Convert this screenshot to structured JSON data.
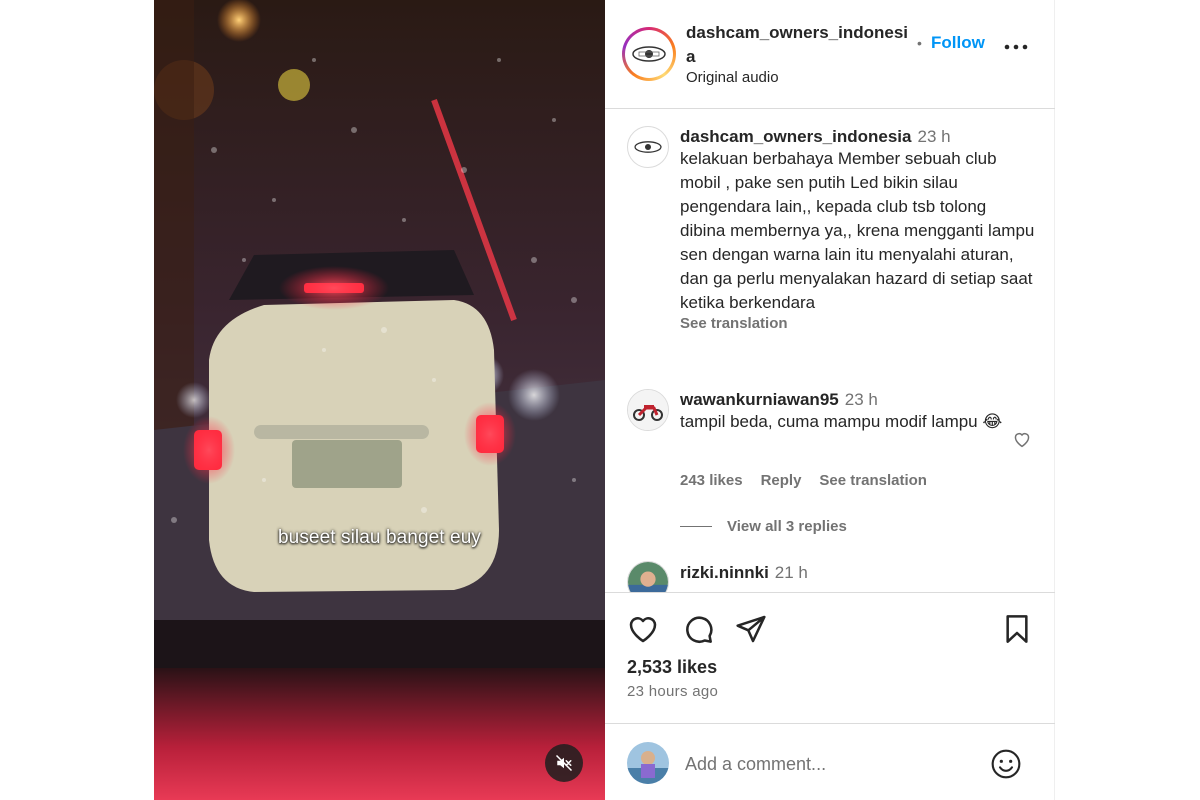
{
  "video": {
    "subtitle": "buseet silau banget euy",
    "mute_icon": "speaker-muted-icon"
  },
  "header": {
    "username": "dashcam_owners_indonesia",
    "separator": "•",
    "follow_label": "Follow",
    "audio_label": "Original audio",
    "more_icon": "more-horizontal-icon"
  },
  "caption": {
    "username": "dashcam_owners_indonesia",
    "time": "23 h",
    "text": "kelakuan berbahaya Member sebuah club mobil , pake sen putih Led bikin silau pengendara lain,, kepada club tsb tolong dibina membernya ya,, krena mengganti lampu sen dengan warna lain itu menyalahi aturan, dan ga perlu menyalakan hazard di setiap saat ketika berkendara",
    "see_translation": "See translation"
  },
  "comments": [
    {
      "username": "wawankurniawan95",
      "time": "23 h",
      "text": "tampil beda, cuma mampu modif lampu 😂",
      "likes": "243 likes",
      "reply_label": "Reply",
      "see_translation": "See translation",
      "view_replies": "View all 3 replies"
    },
    {
      "username": "rizki.ninnki",
      "time": "21 h"
    }
  ],
  "actions": {
    "likes": "2,533 likes",
    "time_ago": "23 hours ago"
  },
  "add_comment": {
    "placeholder": "Add a comment..."
  },
  "colors": {
    "link_blue": "#0095f6",
    "secondary_text": "#737373",
    "border": "#dbdbdb"
  }
}
